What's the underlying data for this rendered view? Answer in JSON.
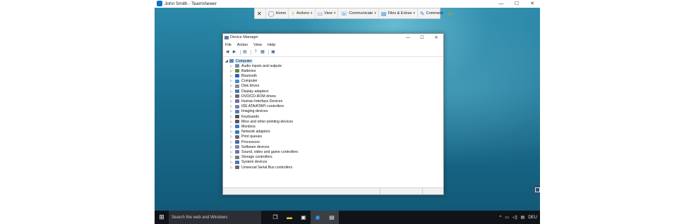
{
  "window": {
    "title": "John Smith - TeamViewer",
    "controls": [
      "—",
      "☐",
      "✕"
    ]
  },
  "teamviewer_toolbar": {
    "close": "✕",
    "items": [
      {
        "label": "Home",
        "icon": "home-icon",
        "glyph": "◯",
        "dropdown": false
      },
      {
        "label": "Actions",
        "icon": "lightning-icon",
        "glyph": "⚡",
        "dropdown": true
      },
      {
        "label": "View",
        "icon": "monitor-icon",
        "glyph": "▭",
        "dropdown": true
      },
      {
        "label": "Communicate",
        "icon": "communicate-icon",
        "glyph": "☏",
        "dropdown": true
      },
      {
        "label": "Files & Extras",
        "icon": "files-icon",
        "glyph": "▤",
        "dropdown": true
      },
      {
        "label": "Comment",
        "icon": "comment-icon",
        "glyph": "✎",
        "dropdown": false
      }
    ],
    "smiley": "☺"
  },
  "device_manager": {
    "title": "Device Manager",
    "menu": [
      "File",
      "Action",
      "View",
      "Help"
    ],
    "toolbar_icons": [
      "back-icon",
      "forward-icon",
      "properties-icon",
      "help-icon",
      "update-icon",
      "monitor-icon"
    ],
    "root": "Computer",
    "items": [
      "Audio inputs and outputs",
      "Batteries",
      "Bluetooth",
      "Computer",
      "Disk drives",
      "Display adapters",
      "DVD/CD-ROM drives",
      "Human Interface Devices",
      "IDE ATA/ATAPI controllers",
      "Imaging devices",
      "Keyboards",
      "Mice and other pointing devices",
      "Monitors",
      "Network adapters",
      "Print queues",
      "Processors",
      "Software devices",
      "Sound, video and game controllers",
      "Storage controllers",
      "System devices",
      "Universal Serial Bus controllers"
    ]
  },
  "taskbar": {
    "search_placeholder": "Search the web and Windows",
    "apps": [
      "task-view-icon",
      "file-explorer-icon",
      "store-icon",
      "teamviewer-icon",
      "device-manager-icon"
    ],
    "tray": [
      "^",
      "▭",
      "◁)",
      "▤",
      "DEU"
    ]
  }
}
